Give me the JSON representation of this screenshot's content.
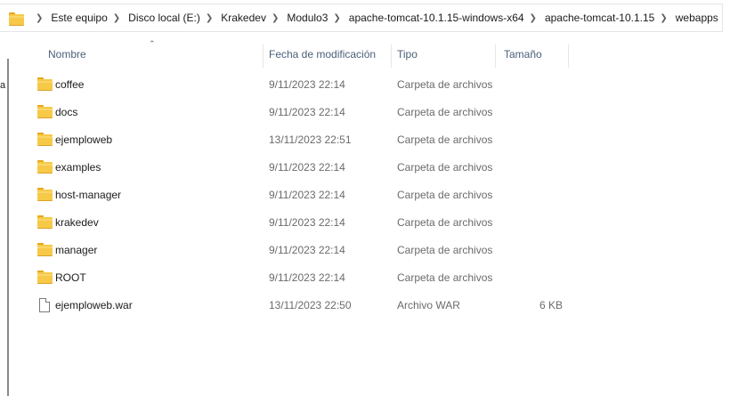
{
  "breadcrumb": {
    "items": [
      {
        "label": "Este equipo"
      },
      {
        "label": "Disco local (E:)"
      },
      {
        "label": "Krakedev"
      },
      {
        "label": "Modulo3"
      },
      {
        "label": "apache-tomcat-10.1.15-windows-x64"
      },
      {
        "label": "apache-tomcat-10.1.15"
      },
      {
        "label": "webapps"
      }
    ]
  },
  "navpane": {
    "partial_text": "a"
  },
  "columns": {
    "name": "Nombre",
    "date": "Fecha de modificación",
    "type": "Tipo",
    "size": "Tamaño",
    "sorted_by": "name",
    "sort_direction": "ascending"
  },
  "files": [
    {
      "name": "coffee",
      "date": "9/11/2023 22:14",
      "type": "Carpeta de archivos",
      "size": "",
      "icon": "folder-icon"
    },
    {
      "name": "docs",
      "date": "9/11/2023 22:14",
      "type": "Carpeta de archivos",
      "size": "",
      "icon": "folder-icon"
    },
    {
      "name": "ejemploweb",
      "date": "13/11/2023 22:51",
      "type": "Carpeta de archivos",
      "size": "",
      "icon": "folder-icon"
    },
    {
      "name": "examples",
      "date": "9/11/2023 22:14",
      "type": "Carpeta de archivos",
      "size": "",
      "icon": "folder-icon"
    },
    {
      "name": "host-manager",
      "date": "9/11/2023 22:14",
      "type": "Carpeta de archivos",
      "size": "",
      "icon": "folder-icon"
    },
    {
      "name": "krakedev",
      "date": "9/11/2023 22:14",
      "type": "Carpeta de archivos",
      "size": "",
      "icon": "folder-icon"
    },
    {
      "name": "manager",
      "date": "9/11/2023 22:14",
      "type": "Carpeta de archivos",
      "size": "",
      "icon": "folder-icon"
    },
    {
      "name": "ROOT",
      "date": "9/11/2023 22:14",
      "type": "Carpeta de archivos",
      "size": "",
      "icon": "folder-icon"
    },
    {
      "name": "ejemploweb.war",
      "date": "13/11/2023 22:50",
      "type": "Archivo WAR",
      "size": "6 KB",
      "icon": "file-icon"
    }
  ]
}
